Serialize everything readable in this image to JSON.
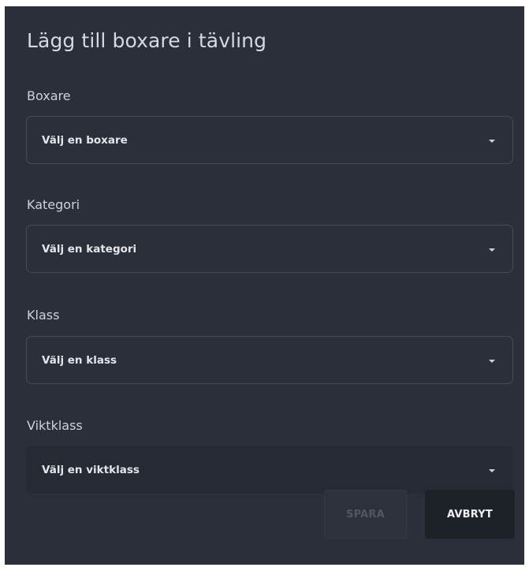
{
  "dialog": {
    "title": "Lägg till boxare i tävling",
    "fields": [
      {
        "label": "Boxare",
        "value": "Välj en boxare",
        "icon": "caret-down-icon"
      },
      {
        "label": "Kategori",
        "value": "Välj en kategori",
        "icon": "caret-down-icon"
      },
      {
        "label": "Klass",
        "value": "Välj en klass",
        "icon": "caret-down-icon"
      },
      {
        "label": "Viktklass",
        "value": "Välj en viktklass",
        "icon": "caret-down-icon"
      }
    ],
    "buttons": {
      "save_label": "SPARA",
      "save_disabled": true,
      "cancel_label": "AVBRYT"
    }
  },
  "colors": {
    "dialog_background": "#2a2f39",
    "text": "#d6d9e0",
    "field_border": "#454b57",
    "disabled_text": "#505663",
    "cancel_background": "#1d2128"
  }
}
